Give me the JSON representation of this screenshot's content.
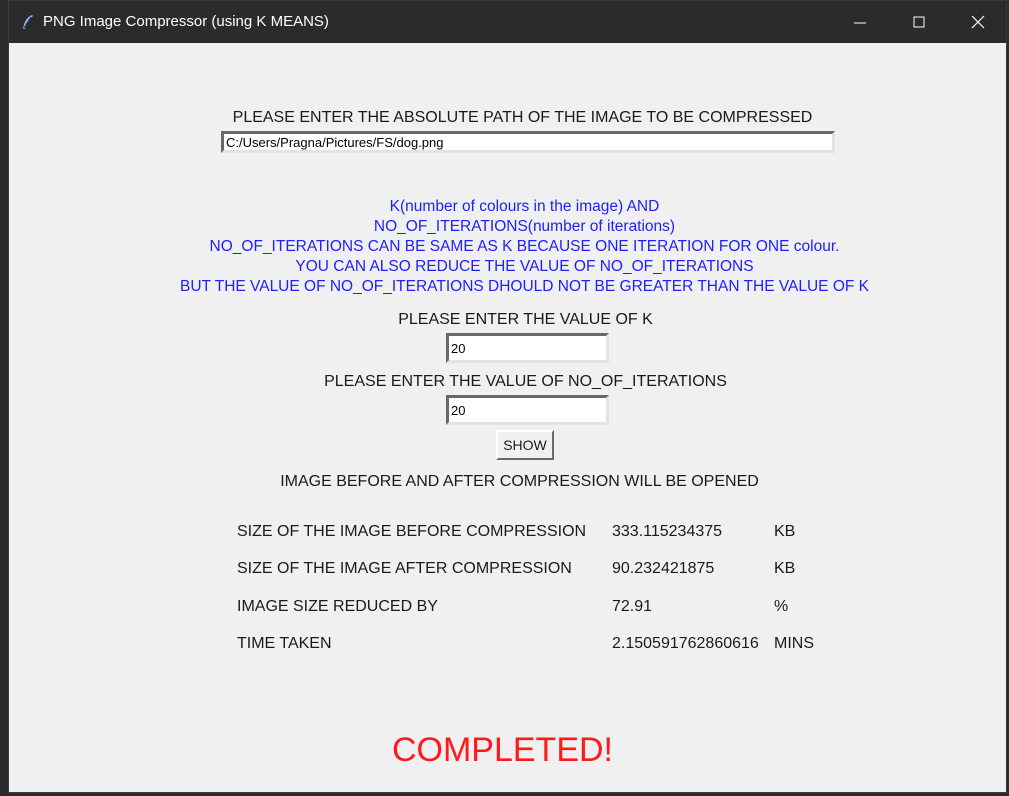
{
  "window": {
    "title": "PNG Image Compressor (using K MEANS)",
    "icon": "feather-icon",
    "controls": [
      "minimize-icon",
      "maximize-icon",
      "close-icon"
    ]
  },
  "path_section": {
    "label": "PLEASE ENTER THE ABSOLUTE PATH OF THE IMAGE TO BE COMPRESSED",
    "value": "C:/Users/Pragna/Pictures/FS/dog.png"
  },
  "info_lines": [
    "K(number of colours in the image) AND",
    "NO_OF_ITERATIONS(number of iterations)",
    "NO_OF_ITERATIONS CAN BE SAME AS K BECAUSE ONE ITERATION FOR ONE colour.",
    "YOU CAN ALSO REDUCE THE VALUE OF NO_OF_ITERATIONS",
    "BUT THE VALUE OF NO_OF_ITERATIONS DHOULD NOT BE GREATER THAN THE VALUE OF K"
  ],
  "k_section": {
    "label": "PLEASE ENTER THE VALUE OF K",
    "value": "20"
  },
  "iter_section": {
    "label": "PLEASE ENTER THE VALUE OF NO_OF_ITERATIONS",
    "value": "20"
  },
  "show_button": "SHOW",
  "open_message": "IMAGE BEFORE AND AFTER COMPRESSION WILL BE OPENED",
  "stats": [
    {
      "label": "SIZE OF THE IMAGE BEFORE COMPRESSION",
      "value": "333.115234375",
      "unit": "KB"
    },
    {
      "label": "SIZE OF THE IMAGE AFTER COMPRESSION",
      "value": "90.232421875",
      "unit": "KB"
    },
    {
      "label": "IMAGE SIZE REDUCED BY",
      "value": "72.91",
      "unit": "%"
    },
    {
      "label": "TIME TAKEN",
      "value": "2.150591762860616",
      "unit": "MINS"
    }
  ],
  "status": "COMPLETED!",
  "colors": {
    "info_text": "#2020ff",
    "status_text": "#ff1a1a",
    "titlebar": "#2b2b2b",
    "window_bg": "#f0f0f0"
  }
}
